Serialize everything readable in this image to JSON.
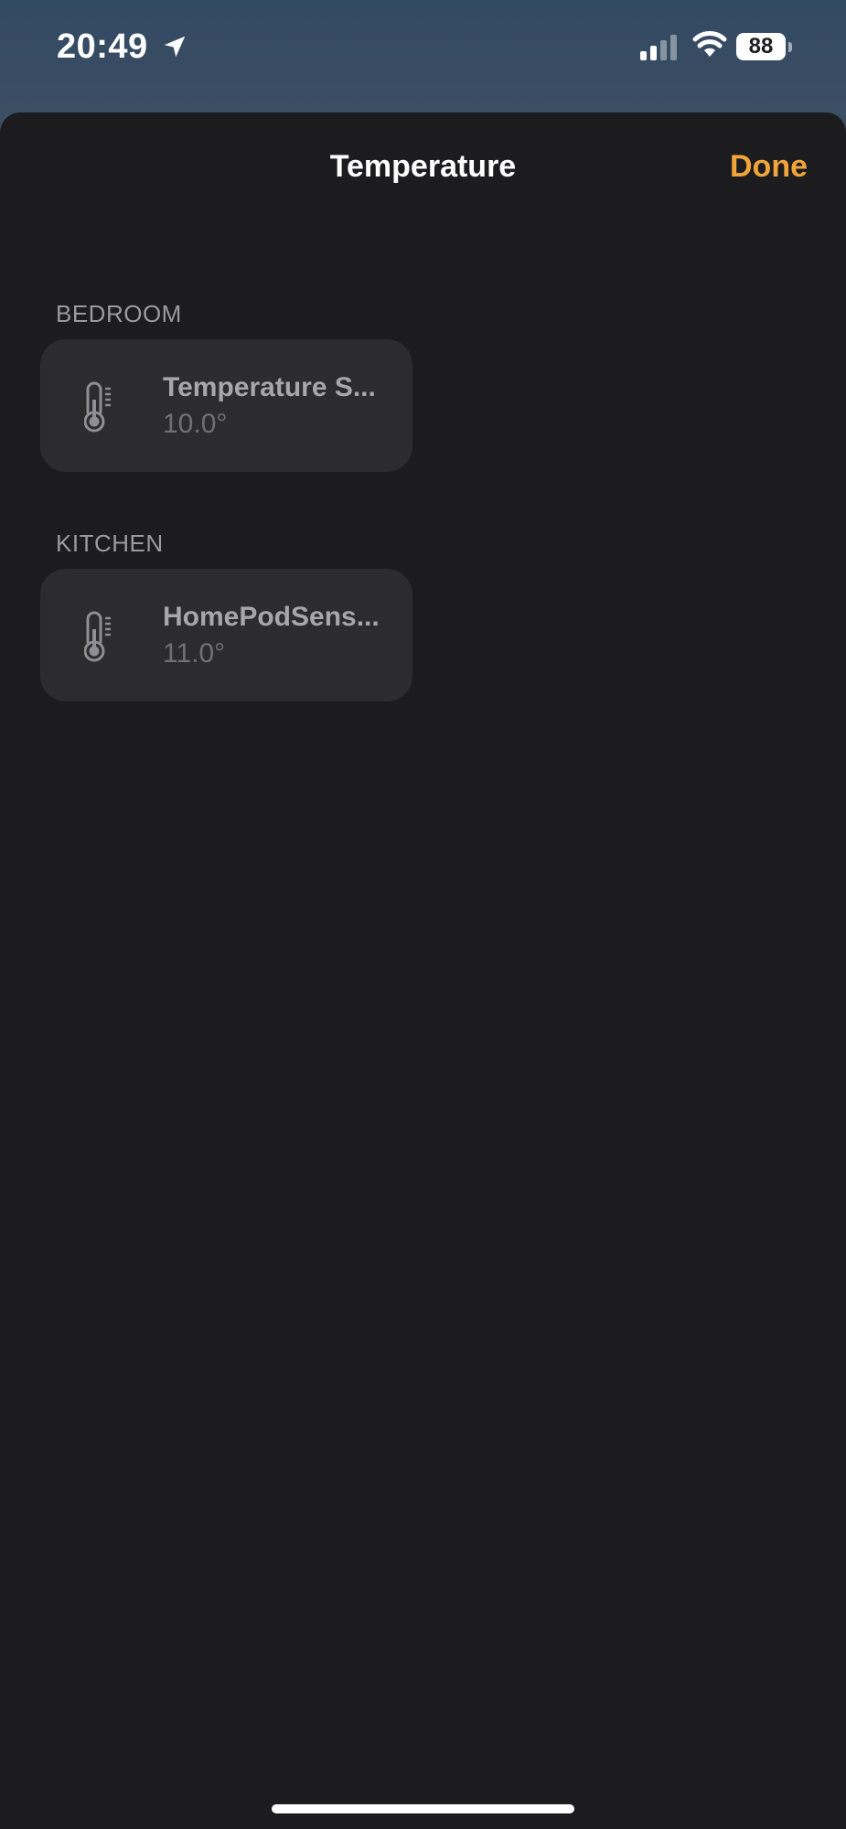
{
  "status_bar": {
    "time": "20:49",
    "battery": "88",
    "icons": [
      "location-arrow-icon",
      "cellular-signal-icon",
      "wifi-icon",
      "battery-icon"
    ]
  },
  "sheet": {
    "title": "Temperature",
    "done_label": "Done"
  },
  "sections": [
    {
      "header": "BEDROOM",
      "accessories": [
        {
          "name": "Temperature S...",
          "value": "10.0°",
          "icon": "thermometer-icon"
        }
      ]
    },
    {
      "header": "KITCHEN",
      "accessories": [
        {
          "name": "HomePodSens...",
          "value": "11.0°",
          "icon": "thermometer-icon"
        }
      ]
    }
  ],
  "colors": {
    "accent": "#f0a43b",
    "sheet_background": "#1c1c1e",
    "tile_background": "#2c2c2e"
  }
}
